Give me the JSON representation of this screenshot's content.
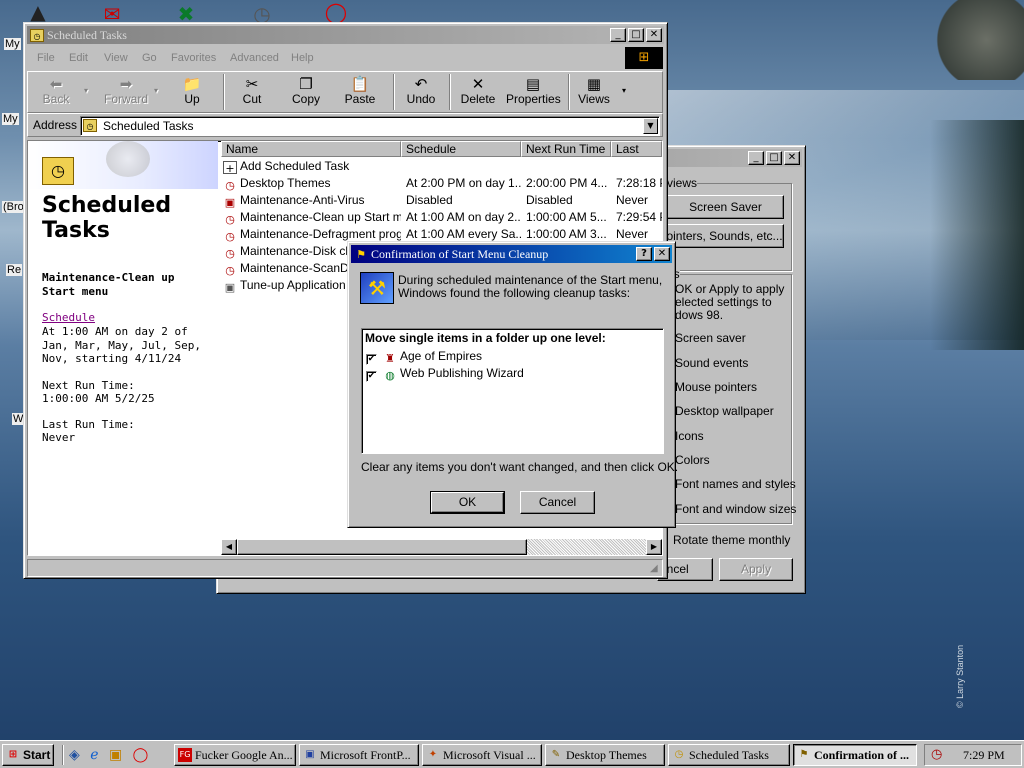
{
  "desktop": {
    "side_labels": [
      "My",
      "My",
      "(Bro",
      "Re",
      "W"
    ],
    "photo_credit": "© Larry Stanton"
  },
  "display_props": {
    "group1_title": "views",
    "screen_saver_button": "Screen Saver",
    "pointers_button": "ointers, Sounds, etc...",
    "group2_title": "gs",
    "info_text": "OK or Apply to apply elected settings to dows 98.",
    "items": [
      "Screen saver",
      "Sound events",
      "Mouse pointers",
      "Desktop wallpaper",
      "Icons",
      "Colors",
      "Font names and styles",
      "Font and window sizes"
    ],
    "rotate_label": "Rotate theme monthly",
    "cancel_label": "ancel",
    "apply_label": "Apply"
  },
  "explorer": {
    "title": "Scheduled Tasks",
    "menu": [
      "File",
      "Edit",
      "View",
      "Go",
      "Favorites",
      "Advanced",
      "Help"
    ],
    "toolbar": [
      "Back",
      "Forward",
      "Up",
      "Cut",
      "Copy",
      "Paste",
      "Undo",
      "Delete",
      "Properties",
      "Views"
    ],
    "address_label": "Address",
    "address_value": "Scheduled Tasks",
    "side_title": "Scheduled Tasks",
    "selected_name": "Maintenance-Clean up Start menu",
    "schedule_link": "Schedule",
    "schedule_detail": "At 1:00 AM on day 2 of Jan, Mar, May, Jul, Sep, Nov, starting 4/11/24",
    "next_run_label": "Next Run Time:",
    "next_run_value": "1:00:00 AM 5/2/25",
    "last_run_label": "Last Run Time:",
    "last_run_value": "Never",
    "columns": [
      "Name",
      "Schedule",
      "Next Run Time",
      "Last Run"
    ],
    "rows": [
      {
        "name": "Add Scheduled Task",
        "schedule": "",
        "next": "",
        "last": ""
      },
      {
        "name": "Desktop Themes",
        "schedule": "At 2:00 PM on day 1...",
        "next": "2:00:00 PM 4...",
        "last": "7:28:18 PI"
      },
      {
        "name": "Maintenance-Anti-Virus",
        "schedule": "Disabled",
        "next": "Disabled",
        "last": "Never"
      },
      {
        "name": "Maintenance-Clean up Start me...",
        "schedule": "At 1:00 AM on day 2...",
        "next": "1:00:00 AM 5...",
        "last": "7:29:54 PI"
      },
      {
        "name": "Maintenance-Defragment progr...",
        "schedule": "At 1:00 AM every Sa...",
        "next": "1:00:00 AM 3...",
        "last": "Never"
      },
      {
        "name": "Maintenance-Disk clea",
        "schedule": "",
        "next": "",
        "last": ""
      },
      {
        "name": "Maintenance-ScanDisk",
        "schedule": "",
        "next": "",
        "last": ""
      },
      {
        "name": "Tune-up Application St",
        "schedule": "",
        "next": "",
        "last": ""
      }
    ]
  },
  "dialog": {
    "title": "Confirmation of Start Menu Cleanup",
    "help": "?",
    "message": "During scheduled maintenance of the Start menu, Windows found the following cleanup tasks:",
    "list_header": "Move single items in a folder up one level:",
    "items": [
      "Age of Empires",
      "Web Publishing Wizard"
    ],
    "footer": "Clear any items you don't want changed, and then click OK.",
    "ok": "OK",
    "cancel": "Cancel"
  },
  "taskbar": {
    "start": "Start",
    "buttons": [
      "Fucker Google An...",
      "Microsoft FrontP...",
      "Microsoft Visual ...",
      "Desktop Themes",
      "Scheduled Tasks",
      "Confirmation of ..."
    ],
    "clock": "7:29 PM"
  }
}
